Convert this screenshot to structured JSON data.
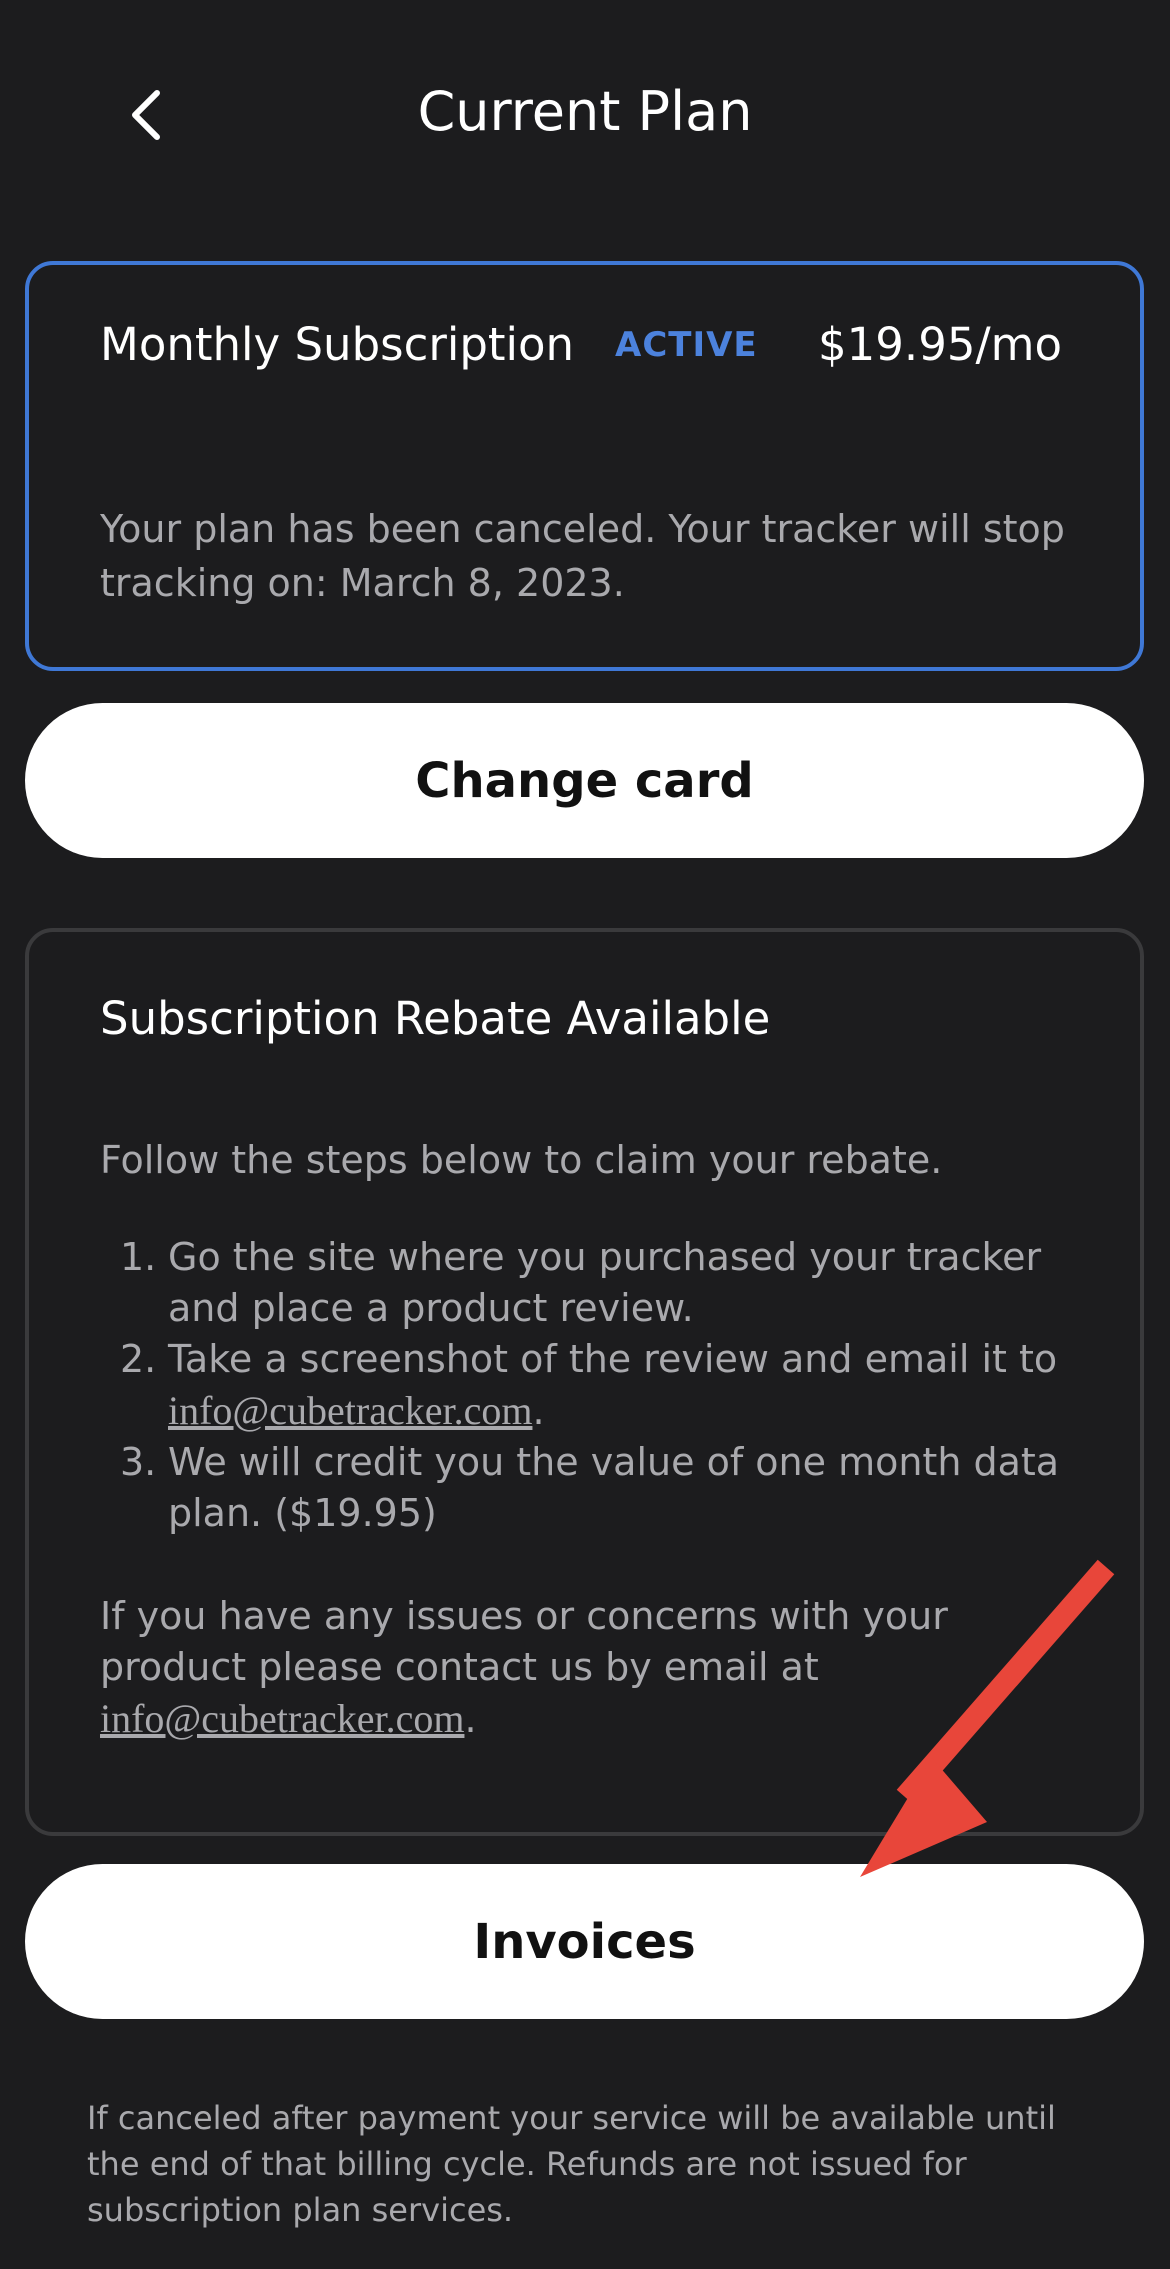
{
  "header": {
    "title": "Current Plan",
    "back_icon": "chevron-left-icon"
  },
  "plan": {
    "name": "Monthly Subscription",
    "status": "ACTIVE",
    "price": "$19.95/mo",
    "note": "Your plan has been canceled. Your tracker will stop tracking on: March 8, 2023.",
    "status_color": "#4c82dd",
    "border_color": "#3f78d6"
  },
  "buttons": {
    "change_card": "Change card",
    "invoices": "Invoices"
  },
  "rebate": {
    "title": "Subscription Rebate Available",
    "intro": "Follow the steps below to claim your rebate.",
    "steps": [
      {
        "number": "1.",
        "text": "Go the site where you purchased your tracker and place a product review."
      },
      {
        "number": "2.",
        "text": "Take a screenshot of the review and email it to ",
        "link": "info@cubetracker.com",
        "suffix": "."
      },
      {
        "number": "3.",
        "text": "We will credit you the value of one month data plan. ($19.95)"
      }
    ],
    "contact_text": "If you have any issues or concerns with your product please contact us by email at ",
    "contact_link": "info@cubetracker.com",
    "contact_suffix": "."
  },
  "footer": {
    "note": "If canceled after payment your service will be available until the end of that billing cycle. Refunds are not issued for subscription plan services."
  },
  "annotation": {
    "arrow_icon": "red-arrow-annotation",
    "color": "#e8463a"
  }
}
